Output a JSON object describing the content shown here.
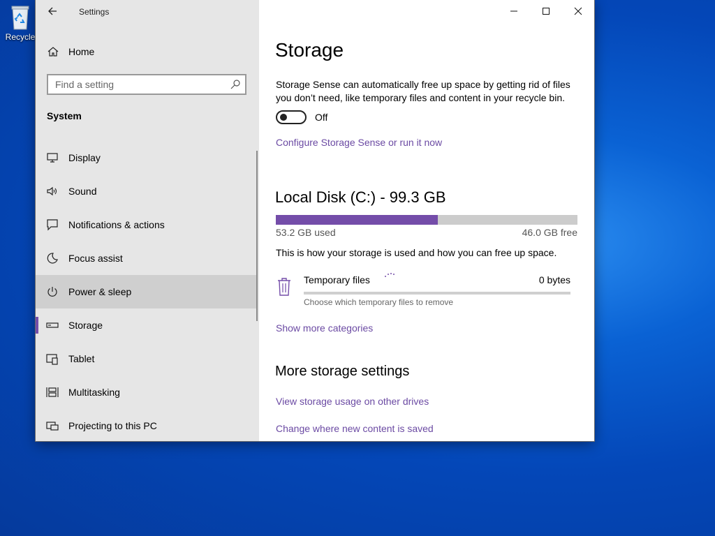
{
  "desktop": {
    "recycle_bin_label": "Recycle"
  },
  "window": {
    "title": "Settings",
    "controls": [
      "minimize",
      "maximize",
      "close"
    ]
  },
  "sidebar": {
    "home_label": "Home",
    "search_placeholder": "Find a setting",
    "section_title": "System",
    "items": [
      {
        "label": "Display",
        "icon": "display-icon"
      },
      {
        "label": "Sound",
        "icon": "speaker-icon"
      },
      {
        "label": "Notifications & actions",
        "icon": "notification-icon"
      },
      {
        "label": "Focus assist",
        "icon": "moon-icon"
      },
      {
        "label": "Power & sleep",
        "icon": "power-icon",
        "state": "hover"
      },
      {
        "label": "Storage",
        "icon": "drive-icon",
        "state": "selected"
      },
      {
        "label": "Tablet",
        "icon": "tablet-icon"
      },
      {
        "label": "Multitasking",
        "icon": "multitasking-icon"
      },
      {
        "label": "Projecting to this PC",
        "icon": "projector-icon"
      }
    ]
  },
  "main": {
    "title": "Storage",
    "storage_sense_description": "Storage Sense can automatically free up space by getting rid of files you don’t need, like temporary files and content in your recycle bin.",
    "storage_sense_toggle": "Off",
    "configure_link": "Configure Storage Sense or run it now",
    "disk": {
      "title": "Local Disk (C:) - 99.3 GB",
      "used_label": "53.2 GB used",
      "free_label": "46.0 GB free",
      "used_fraction": 0.536
    },
    "usage_hint": "This is how your storage is used and how you can free up space.",
    "categories": [
      {
        "name": "Temporary files",
        "size": "0 bytes",
        "subtitle": "Choose which temporary files to remove"
      }
    ],
    "show_more_link": "Show more categories",
    "more_settings_title": "More storage settings",
    "more_links": [
      "View storage usage on other drives",
      "Change where new content is saved"
    ]
  },
  "colors": {
    "accent": "#744da9",
    "link": "#6b4aa3",
    "sidebar_bg": "#e6e6e6"
  }
}
